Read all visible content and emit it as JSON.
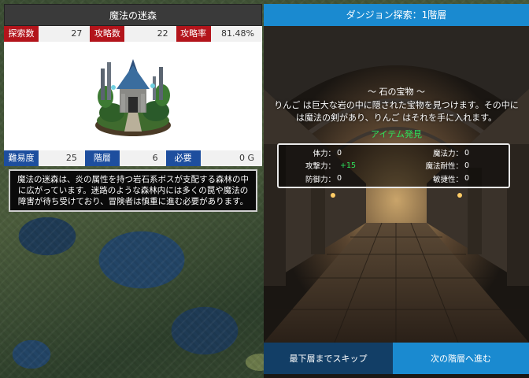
{
  "dungeon_info": {
    "title": "魔法の迷森",
    "stats_row1": [
      {
        "label": "探索数",
        "value": "27"
      },
      {
        "label": "攻略数",
        "value": "22"
      },
      {
        "label": "攻略率",
        "value": "81.48%"
      }
    ],
    "stats_row2": [
      {
        "label": "難易度",
        "value": "25"
      },
      {
        "label": "階層",
        "value": "6"
      },
      {
        "label": "必要",
        "value": "0 G"
      }
    ],
    "description": "魔法の迷森は、炎の属性を持つ岩石系ボスが支配する森林の中に広がっています。迷路のような森林内には多くの罠や魔法の障害が待ち受けており、冒険者は慎重に進む必要があります。",
    "image_icon": "forest-shrine-icon"
  },
  "exploration": {
    "title": "ダンジョン探索：1階層",
    "event_title": "～ 石の宝物 ～",
    "event_text": "りんご は巨大な岩の中に隠された宝物を見つけます。その中には魔法の剣があり、りんご はそれを手に入れます。",
    "event_result": "アイテム発見",
    "params": {
      "hp": {
        "label": "体力：",
        "value": "0"
      },
      "mp": {
        "label": "魔法力：",
        "value": "0"
      },
      "atk": {
        "label": "攻撃力：",
        "value": "+15"
      },
      "mres": {
        "label": "魔法耐性：",
        "value": "0"
      },
      "def": {
        "label": "防御力：",
        "value": "0"
      },
      "agi": {
        "label": "敏捷性：",
        "value": "0"
      }
    }
  },
  "buttons": {
    "skip": "最下層までスキップ",
    "next": "次の階層へ進む"
  },
  "colors": {
    "red_label": "#b3141b",
    "blue_label": "#1d4e9e",
    "accent": "#1a8ad0",
    "dark_button": "#123e66",
    "bonus_green": "#2ee05a"
  }
}
